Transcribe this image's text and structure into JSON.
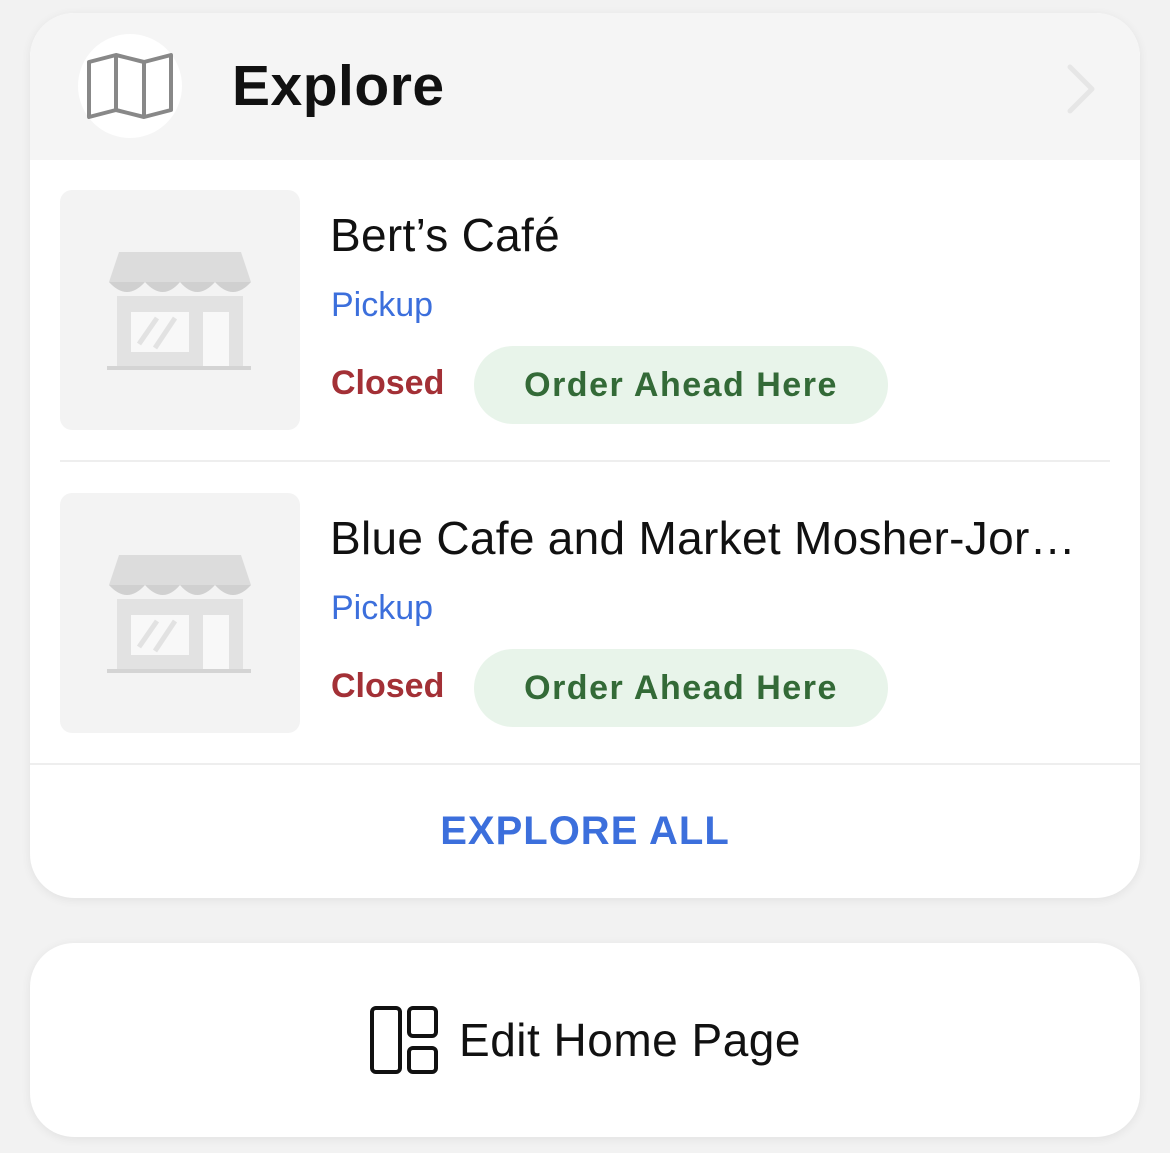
{
  "explore": {
    "title": "Explore",
    "header_icon": "map-icon",
    "chevron_icon": "chevron-right-icon",
    "stores": [
      {
        "name": "Bert’s Café",
        "mode": "Pickup",
        "status": "Closed",
        "action": "Order Ahead Here",
        "thumbnail_icon": "storefront-icon"
      },
      {
        "name": "Blue Cafe and Market Mosher-Jor…",
        "mode": "Pickup",
        "status": "Closed",
        "action": "Order Ahead Here",
        "thumbnail_icon": "storefront-icon"
      }
    ],
    "explore_all_label": "EXPLORE ALL"
  },
  "edit": {
    "label": "Edit Home Page",
    "icon": "layout-grid-icon"
  },
  "colors": {
    "accent_blue": "#3c6fdc",
    "closed_red": "#a33036",
    "order_green": "#336a37",
    "order_pill_bg": "#e8f4ea"
  }
}
